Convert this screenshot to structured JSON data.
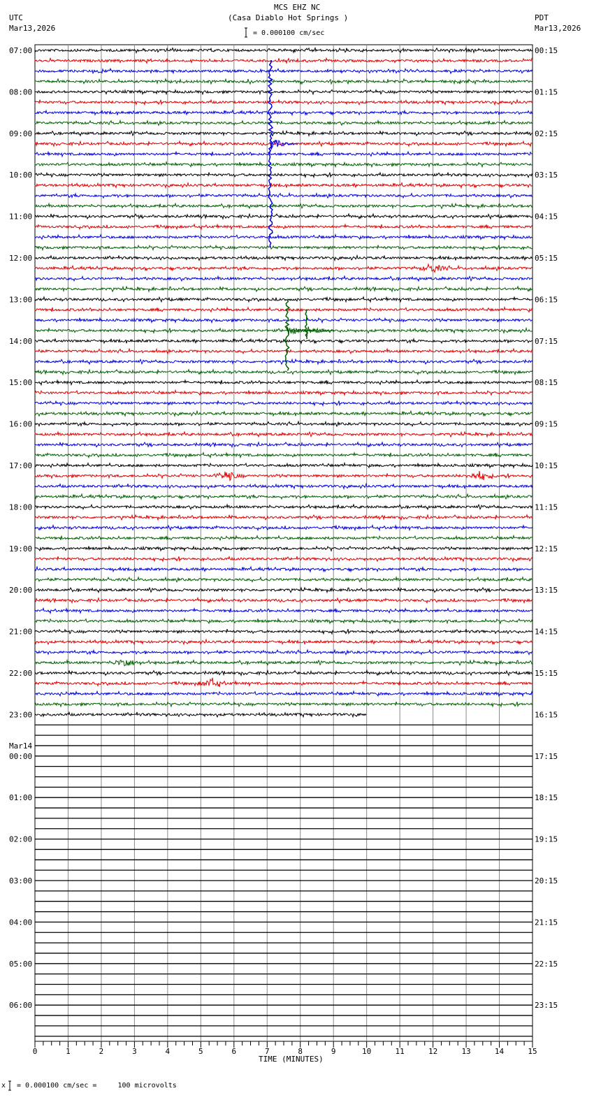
{
  "header": {
    "title": "MCS EHZ NC",
    "subtitle": "(Casa Diablo Hot Springs )",
    "left_tz": "UTC",
    "left_date": "Mar13,2026",
    "right_tz": "PDT",
    "right_date": "Mar13,2026",
    "scale": "= 0.000100 cm/sec"
  },
  "footer": {
    "scale": "= 0.000100 cm/sec =     100 microvolts",
    "mark": "x"
  },
  "chart_data": {
    "type": "line",
    "xlabel": "TIME (MINUTES)",
    "xlim": [
      0,
      15
    ],
    "xticks": [
      "0",
      "1",
      "2",
      "3",
      "4",
      "5",
      "6",
      "7",
      "8",
      "9",
      "10",
      "11",
      "12",
      "13",
      "14",
      "15"
    ],
    "left_labels": [
      "07:00",
      "08:00",
      "09:00",
      "10:00",
      "11:00",
      "12:00",
      "13:00",
      "14:00",
      "15:00",
      "16:00",
      "17:00",
      "18:00",
      "19:00",
      "20:00",
      "21:00",
      "22:00",
      "23:00",
      "00:00",
      "01:00",
      "02:00",
      "03:00",
      "04:00",
      "05:00",
      "06:00"
    ],
    "left_date_change": {
      "index": 17,
      "label": "Mar14"
    },
    "right_labels": [
      "00:15",
      "01:15",
      "02:15",
      "03:15",
      "04:15",
      "05:15",
      "06:15",
      "07:15",
      "08:15",
      "09:15",
      "10:15",
      "11:15",
      "12:15",
      "13:15",
      "14:15",
      "15:15",
      "16:15",
      "17:15",
      "18:15",
      "19:15",
      "20:15",
      "21:15",
      "22:15",
      "23:15"
    ],
    "trace_colors": [
      "#000000",
      "#e00000",
      "#0000e0",
      "#006000"
    ],
    "lines_per_hour": 4,
    "recorded_traces": 65,
    "last_trace_minutes": 10,
    "events": [
      {
        "row": 9,
        "minute": 7.1,
        "rows_span": [
          1,
          19
        ],
        "color_index": 2
      },
      {
        "row": 27,
        "minute": 7.6,
        "rows_span": [
          24,
          31
        ],
        "color_index": 3
      },
      {
        "row": 27,
        "minute": 8.2,
        "rows_span": [
          25,
          28
        ],
        "color_index": 3
      },
      {
        "row": 21,
        "minute": 12.0,
        "rows_span": [
          21,
          21
        ],
        "color_index": 1
      },
      {
        "row": 41,
        "minute": 5.8,
        "rows_span": [
          41,
          41
        ],
        "color_index": 1
      },
      {
        "row": 41,
        "minute": 13.4,
        "rows_span": [
          41,
          41
        ],
        "color_index": 1
      },
      {
        "row": 59,
        "minute": 2.7,
        "rows_span": [
          59,
          59
        ],
        "color_index": 3
      },
      {
        "row": 61,
        "minute": 5.3,
        "rows_span": [
          61,
          61
        ],
        "color_index": 1
      }
    ]
  }
}
